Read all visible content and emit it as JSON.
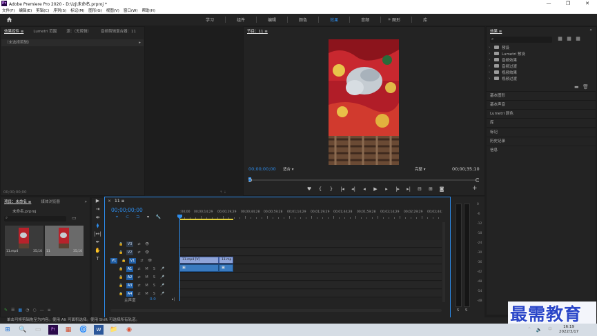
{
  "window": {
    "app_badge": "Pr",
    "title": "Adobe Premiere Pro 2020 - D:\\lzj\\未命名.prproj *",
    "controls": [
      "—",
      "❐",
      "✕"
    ]
  },
  "menu": [
    "文件(F)",
    "编辑(E)",
    "剪辑(C)",
    "序列(S)",
    "标记(M)",
    "图形(G)",
    "视图(V)",
    "窗口(W)",
    "帮助(H)"
  ],
  "workspaces": {
    "tabs": [
      {
        "label": "学习",
        "active": false
      },
      {
        "label": "组件",
        "active": false
      },
      {
        "label": "编辑",
        "active": false
      },
      {
        "label": "颜色",
        "active": false
      },
      {
        "label": "效果",
        "active": true
      },
      {
        "label": "音频",
        "active": false
      },
      {
        "label": "图形",
        "active": false
      },
      {
        "label": "库",
        "active": false
      }
    ],
    "more": "»"
  },
  "effect_controls": {
    "tabs": [
      "效果控件 ≡",
      "Lumetri 范围",
      "源：（无剪辑）",
      "音频剪辑混合器：11"
    ],
    "no_clip": "（未选择剪辑）",
    "arrow": "▸",
    "timecode": "00;00;00;00",
    "footer_icons": "⇡ ⇣"
  },
  "program": {
    "tab": "节目：11 ≡",
    "timecode": "00;00;00;00",
    "fit": "适合",
    "quality": "完整",
    "duration": "00;00;35;10",
    "transport": [
      "♥",
      "{",
      "}",
      "|◂",
      "◂|",
      "◂",
      "▶",
      "▸",
      "|▸",
      "▸|",
      "⊟",
      "⊞",
      "◙",
      "⧉"
    ],
    "add": "+"
  },
  "effects": {
    "tab": "效果 ≡",
    "more": "»",
    "toolbar_icons": [
      "▦",
      "▦",
      "▦"
    ],
    "tree": [
      "预设",
      "Lumetri 预设",
      "音频效果",
      "音频过渡",
      "视频效果",
      "视频过渡"
    ],
    "footer_icons": [
      "▬",
      "🗑"
    ],
    "collapsed": [
      "基本图形",
      "基本声音",
      "Lumetri 颜色",
      "库",
      "标记",
      "历史记录",
      "信息"
    ]
  },
  "project": {
    "tabs": [
      "项目：未命名 ≡",
      "媒体浏览器"
    ],
    "more": "»",
    "file": "未命名.prproj",
    "items": [
      {
        "name": "11.mp4",
        "duration": "35;10"
      },
      {
        "name": "11",
        "duration": "35;10"
      }
    ],
    "footer_icons": [
      "✎",
      "☰",
      "▦",
      "◔",
      "○",
      "—",
      "≡",
      "▭",
      "▦",
      "🗑"
    ]
  },
  "tools": [
    "▶",
    "⇥",
    "⇹",
    "⧫",
    "|↔|",
    "✒",
    "✋",
    "T"
  ],
  "timeline": {
    "close": "×",
    "tab": "11 ≡",
    "timecode": "00;00;00;00",
    "tool_icons": [
      "⌖",
      "⊂",
      "⊐",
      "▾",
      "🔧"
    ],
    "ruler": [
      ":00;00",
      "00;00;14;29",
      "00;00;29;29",
      "00;00;44;28",
      "00;00;59;28",
      "00;01;14;29",
      "00;01;29;29",
      "00;01;44;28",
      "00;01;59;28",
      "00;02;14;29",
      "00;02;29;29",
      "00;02;44;"
    ],
    "video_tracks": [
      {
        "src": "",
        "id": "V3",
        "target": false
      },
      {
        "src": "",
        "id": "V2",
        "target": false
      },
      {
        "src": "V1",
        "id": "V1",
        "target": true
      }
    ],
    "audio_tracks": [
      {
        "src": "A1",
        "id": "A1"
      },
      {
        "src": "A2",
        "id": "A2"
      },
      {
        "src": "A3",
        "id": "A3"
      },
      {
        "src": "A4",
        "id": "A4"
      }
    ],
    "track_glyphs": {
      "lock": "🔒",
      "sync": "⇄",
      "eye": "👁",
      "mute": "M",
      "solo": "S",
      "mic": "🎤"
    },
    "clips": [
      {
        "label": "11.mp4 [V]"
      },
      {
        "label": "11.mp"
      }
    ],
    "audio_clip_icon": "▣",
    "master_label": "主声道",
    "master_value": "0.0",
    "master_icon": "▸|"
  },
  "meter": {
    "scale": [
      "0",
      "-6",
      "-12",
      "-18",
      "-24",
      "-30",
      "-36",
      "-42",
      "-48",
      "-54",
      "-dB"
    ],
    "channels": [
      "S",
      "S"
    ]
  },
  "status": {
    "text": "单击可将剪辑拖至为内容。使用 Alt 可面积选择。使用 Shift 可选择所有轨道。"
  },
  "taskbar": {
    "icons": [
      "⊞",
      "🔍",
      "▭",
      "Pr",
      "▦",
      "🌀",
      "W",
      "📁",
      "◉"
    ],
    "time": "16:19",
    "date": "2022/3/17",
    "tray_icons": [
      "^",
      "🔈",
      "中"
    ]
  },
  "watermark": "最需教育",
  "colors": {
    "accent": "#2d8ceb",
    "panel": "#232323",
    "video_clip": "#8fa4d8",
    "audio_clip": "#3a7bc0",
    "work_area": "#e3d13b"
  }
}
